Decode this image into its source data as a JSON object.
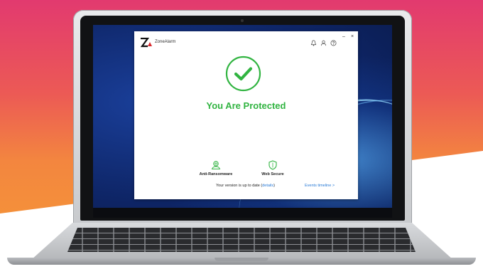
{
  "app": {
    "name": "ZoneAlarm",
    "window_controls": {
      "minimize": "–",
      "close": "×"
    },
    "header_icons": [
      "bell-icon",
      "user-icon",
      "help-icon"
    ],
    "status_title": "You Are Protected",
    "features": [
      {
        "label": "Anti-Ransomware",
        "icon": "ransomware-shield-icon"
      },
      {
        "label": "Web Secure",
        "icon": "shield-icon"
      }
    ],
    "footer": {
      "version_text": "Your version is up to date (",
      "details_link": "details",
      "version_text_end": ")",
      "events_link": "Events timeline >"
    }
  },
  "colors": {
    "accent_green": "#31b441",
    "link_blue": "#2a7bd6",
    "logo_red": "#d7262b"
  }
}
